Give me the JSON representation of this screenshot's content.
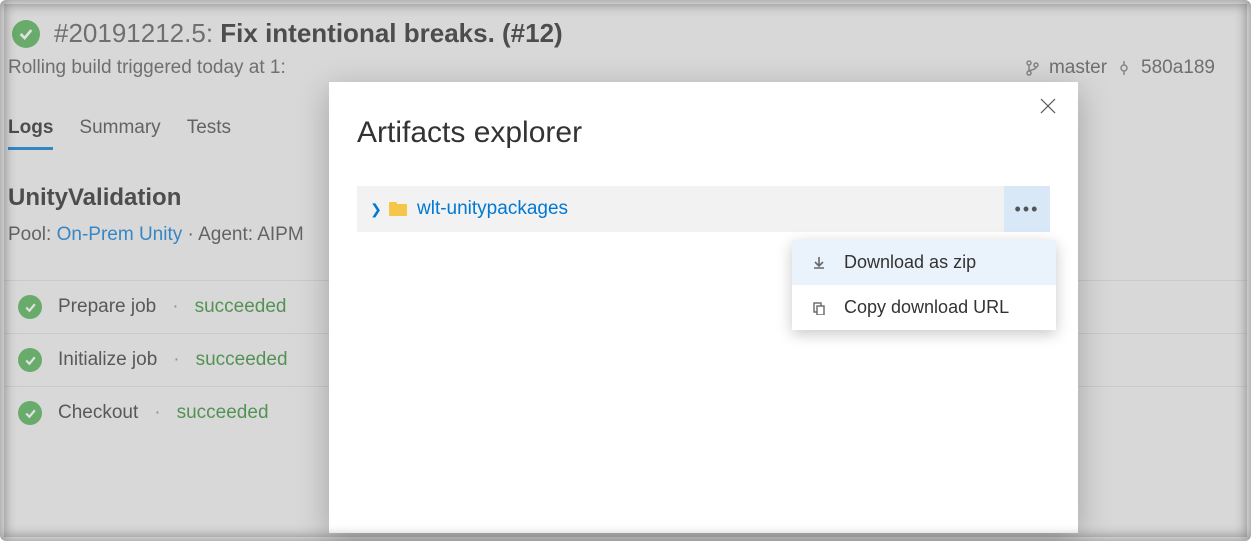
{
  "header": {
    "build_id": "#20191212.5:",
    "build_title": "Fix intentional breaks. (#12)"
  },
  "subline": {
    "trigger_text": "Rolling build triggered today at 1:",
    "branch": "master",
    "commit": "580a189"
  },
  "tabs": {
    "logs": "Logs",
    "summary": "Summary",
    "tests": "Tests"
  },
  "job": {
    "name": "UnityValidation",
    "pool_label": "Pool:",
    "pool_name": "On-Prem Unity",
    "agent_prefix": "· Agent: AIPM"
  },
  "steps": [
    {
      "name": "Prepare job",
      "status": "succeeded"
    },
    {
      "name": "Initialize job",
      "status": "succeeded"
    },
    {
      "name": "Checkout",
      "status": "succeeded"
    }
  ],
  "modal": {
    "title": "Artifacts explorer",
    "artifact_name": "wlt-unitypackages",
    "menu": {
      "download": "Download as zip",
      "copy_url": "Copy download URL"
    }
  }
}
